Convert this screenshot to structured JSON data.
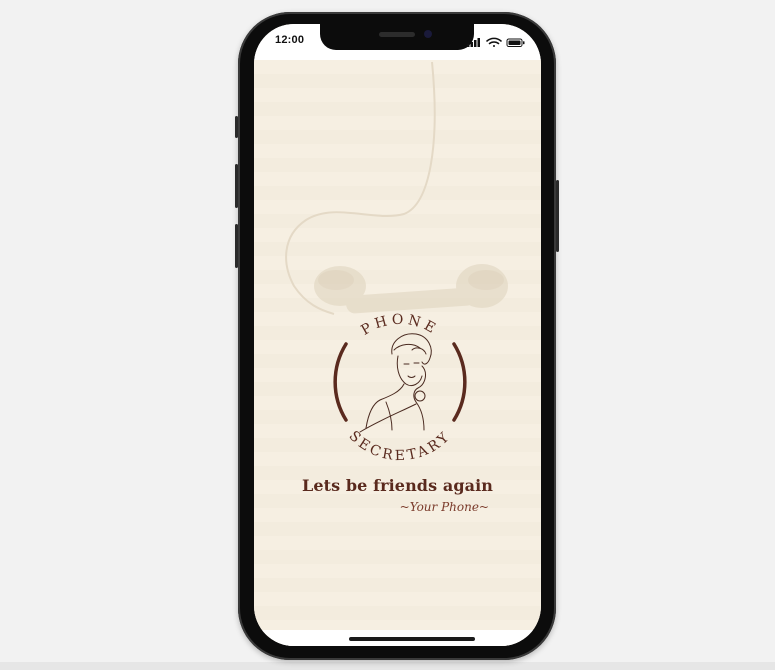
{
  "status_bar": {
    "time": "12:00",
    "icons": [
      "signal-icon",
      "wifi-icon",
      "battery-icon"
    ]
  },
  "logo": {
    "top_text": "PHONE",
    "bottom_text": "SECRETARY",
    "illustration": "woman-on-telephone-illustration"
  },
  "tagline": "Lets be friends again",
  "signature": "~Your Phone~",
  "colors": {
    "background": "#f6f0e4",
    "brand_brown": "#5a2a1e",
    "decor_beige": "#e4d9c6"
  }
}
